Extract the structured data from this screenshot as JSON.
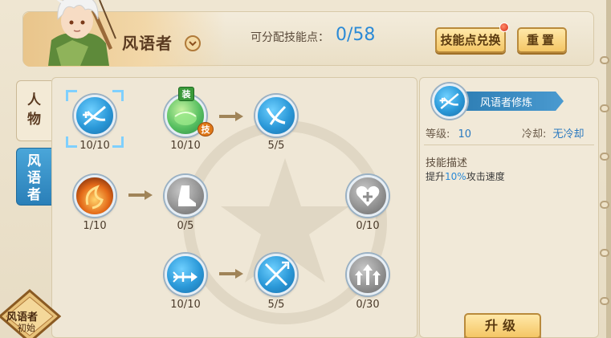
{
  "header": {
    "class_name": "风语者",
    "points_label": "可分配技能点：",
    "points_value": "0/58",
    "exchange_button": "技能点兑换",
    "reset_button": "重置"
  },
  "tabs": [
    {
      "label": "人物"
    },
    {
      "label": "风语者"
    }
  ],
  "skills": [
    {
      "level": "10/10",
      "icon": "bow-arrows-icon"
    },
    {
      "level": "10/10",
      "icon": "green-orb-icon",
      "equip_badge": "装",
      "skill_badge": "技"
    },
    {
      "level": "5/5",
      "icon": "wind-slash-icon"
    },
    {
      "level": "1/10",
      "icon": "fire-swirl-icon"
    },
    {
      "level": "0/5",
      "icon": "boot-icon"
    },
    {
      "level": "0/10",
      "icon": "heart-plus-icon"
    },
    {
      "level": "10/10",
      "icon": "arrow-plus-icon"
    },
    {
      "level": "5/5",
      "icon": "crossed-arrows-icon"
    },
    {
      "level": "0/30",
      "icon": "triple-up-arrows-icon"
    }
  ],
  "detail": {
    "name": "风语者修炼",
    "level_label": "等级:",
    "level_value": "10",
    "cooldown_label": "冷却:",
    "cooldown_value": "无冷却",
    "desc_title": "技能描述",
    "desc_prefix": "提升",
    "desc_highlight": "10%",
    "desc_suffix": "攻击速度",
    "upgrade_button": "升级"
  },
  "class_badge": {
    "title": "风语者",
    "subtitle": "初始"
  },
  "colors": {
    "accent_blue": "#2b8ad6",
    "button_gold": "#f4c665",
    "tab_active": "#2a7fb8"
  }
}
